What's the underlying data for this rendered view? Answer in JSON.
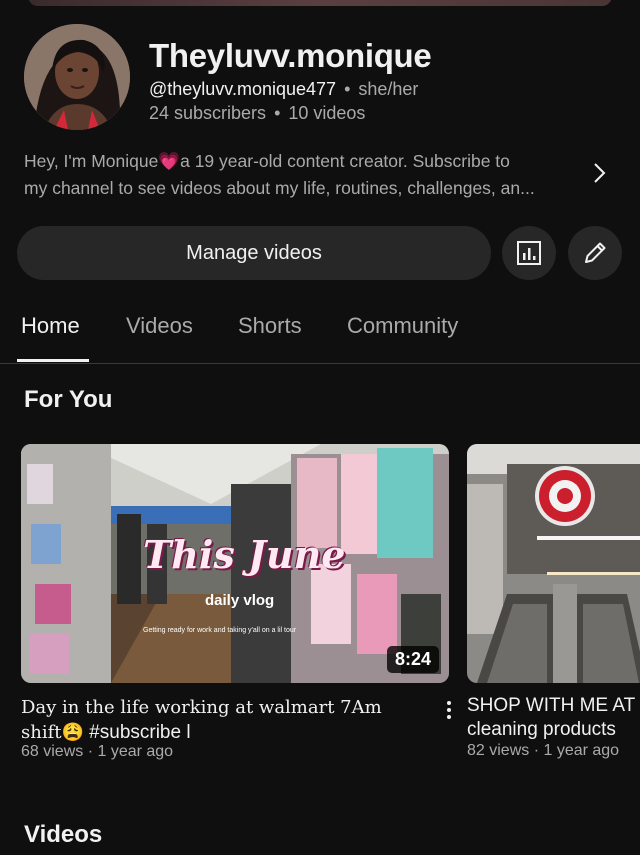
{
  "channel": {
    "name": "Theyluvv.monique",
    "handle": "@theyluvv.monique477",
    "pronouns": "she/her",
    "subscribers": "24 subscribers",
    "videos_count": "10 videos",
    "description_line1": "Hey, I'm Monique💗a 19 year-old  content creator. Subscribe to",
    "description_line2": "my channel to see videos about my life, routines, challenges, an..."
  },
  "actions": {
    "manage_label": "Manage videos",
    "analytics_icon": "analytics-icon",
    "edit_icon": "pencil-icon"
  },
  "tabs": [
    {
      "label": "Home",
      "active": true
    },
    {
      "label": "Videos",
      "active": false
    },
    {
      "label": "Shorts",
      "active": false
    },
    {
      "label": "Community",
      "active": false
    }
  ],
  "sections": {
    "for_you": "For You",
    "videos": "Videos"
  },
  "videos": [
    {
      "thumb_title": "This June",
      "thumb_subtitle": "daily vlog",
      "thumb_caption": "Getting ready for work and taking y'all on a lil tour",
      "duration": "8:24",
      "title_line1": "Day in the life working at walmart 7Am",
      "title_word2": "shift",
      "title_emoji": "😩",
      "title_tail": " #subscribe l",
      "meta": "68 views · 1 year ago"
    },
    {
      "title_line1": "SHOP WITH ME AT TARGET",
      "title_line2": "cleaning products",
      "meta": "82 views · 1 year ago"
    }
  ],
  "colors": {
    "background": "#0f0f0f",
    "button": "#272727",
    "muted_text": "#aaaaaa",
    "heart": "#ff4fa8"
  }
}
